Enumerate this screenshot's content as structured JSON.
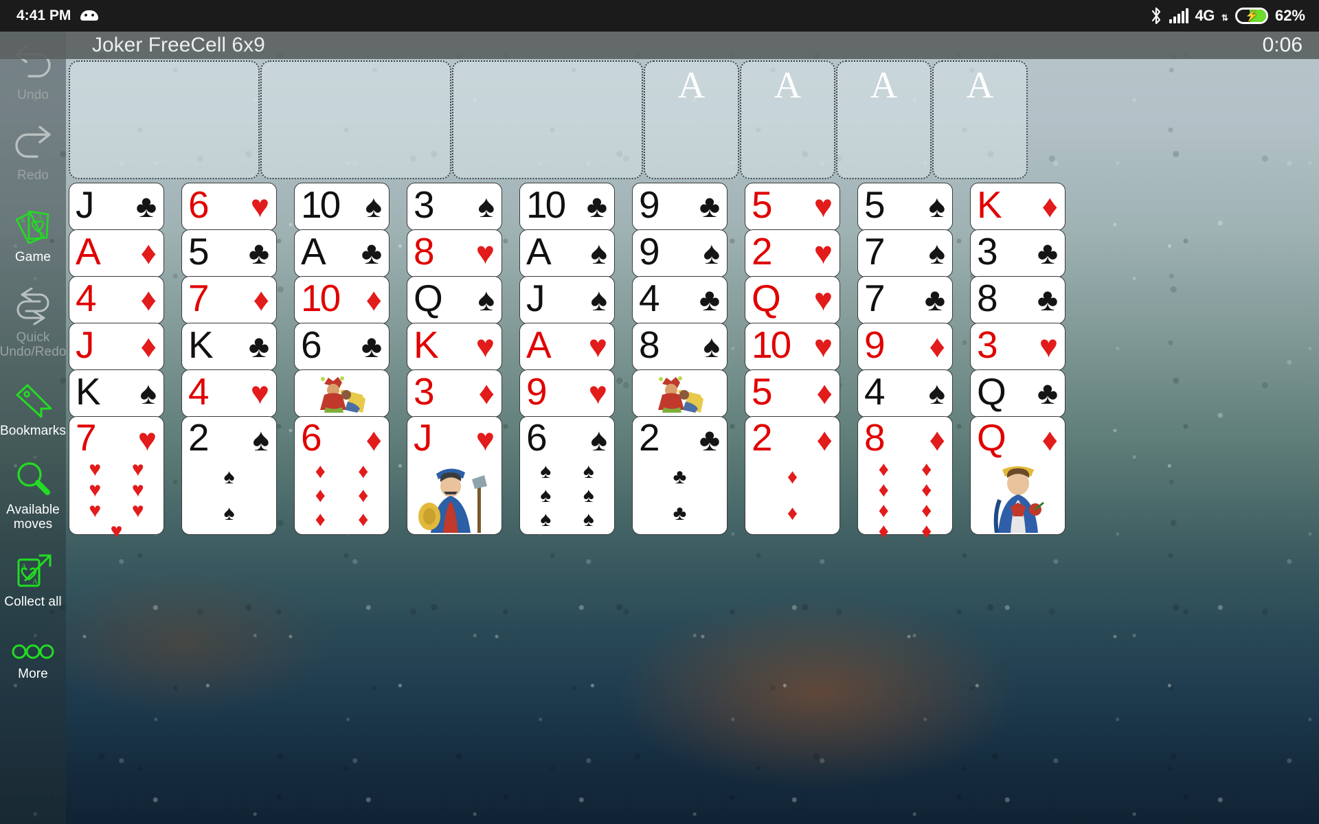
{
  "status_bar": {
    "time": "4:41 PM",
    "android_icon": "android-robot-icon",
    "bluetooth_icon": "bluetooth-icon",
    "signal_icon": "signal-bars-icon",
    "network": "4G",
    "data_arrows": "⇅",
    "battery_icon": "battery-charging-icon",
    "battery_percent": "62%",
    "battery_level": 62,
    "battery_color": "#6ddc2b"
  },
  "title_bar": {
    "title": "Joker FreeCell 6x9",
    "timer": "0:06"
  },
  "sidebar": {
    "items": [
      {
        "label": "Undo",
        "icon": "undo-arrow-icon",
        "enabled": false
      },
      {
        "label": "Redo",
        "icon": "redo-arrow-icon",
        "enabled": false
      },
      {
        "label": "Game",
        "icon": "cards-ace-icon",
        "enabled": true
      },
      {
        "label": "Quick\nUndo/Redo",
        "icon": "quick-undo-redo-icon",
        "enabled": false
      },
      {
        "label": "Bookmarks",
        "icon": "bookmark-tag-icon",
        "enabled": true
      },
      {
        "label": "Available\nmoves",
        "icon": "magnifier-icon",
        "enabled": true
      },
      {
        "label": "Collect\nall",
        "icon": "collect-all-card-arrow-icon",
        "enabled": true
      },
      {
        "label": "More",
        "icon": "three-circles-icon",
        "enabled": true
      }
    ],
    "accent_color": "#22dd22",
    "disabled_color": "#9aa3a4"
  },
  "board": {
    "free_cells": [
      {
        "occupied": false
      },
      {
        "occupied": false
      },
      {
        "occupied": false
      },
      {
        "occupied": false
      },
      {
        "occupied": false
      },
      {
        "occupied": false
      }
    ],
    "foundations": [
      {
        "placeholder": "A",
        "occupied": false
      },
      {
        "placeholder": "A",
        "occupied": false
      },
      {
        "placeholder": "A",
        "occupied": false
      },
      {
        "placeholder": "A",
        "occupied": false
      }
    ],
    "columns": [
      {
        "cards": [
          {
            "rank": "J",
            "suit": "♣",
            "color": "black",
            "type": "rank"
          },
          {
            "rank": "A",
            "suit": "♦",
            "color": "red",
            "type": "rank"
          },
          {
            "rank": "4",
            "suit": "♦",
            "color": "red",
            "type": "rank"
          },
          {
            "rank": "J",
            "suit": "♦",
            "color": "red",
            "type": "rank"
          },
          {
            "rank": "K",
            "suit": "♠",
            "color": "black",
            "type": "rank"
          },
          {
            "rank": "7",
            "suit": "♥",
            "color": "red",
            "type": "pip",
            "pips": 7
          }
        ]
      },
      {
        "cards": [
          {
            "rank": "6",
            "suit": "♥",
            "color": "red",
            "type": "rank"
          },
          {
            "rank": "5",
            "suit": "♣",
            "color": "black",
            "type": "rank"
          },
          {
            "rank": "7",
            "suit": "♦",
            "color": "red",
            "type": "rank"
          },
          {
            "rank": "K",
            "suit": "♣",
            "color": "black",
            "type": "rank"
          },
          {
            "rank": "4",
            "suit": "♥",
            "color": "red",
            "type": "rank"
          },
          {
            "rank": "2",
            "suit": "♠",
            "color": "black",
            "type": "pip",
            "pips": 2
          }
        ]
      },
      {
        "cards": [
          {
            "rank": "10",
            "suit": "♠",
            "color": "black",
            "type": "rank"
          },
          {
            "rank": "A",
            "suit": "♣",
            "color": "black",
            "type": "rank"
          },
          {
            "rank": "10",
            "suit": "♦",
            "color": "red",
            "type": "rank"
          },
          {
            "rank": "6",
            "suit": "♣",
            "color": "black",
            "type": "rank"
          },
          {
            "rank": "",
            "suit": "",
            "color": "red",
            "type": "joker"
          },
          {
            "rank": "6",
            "suit": "♦",
            "color": "red",
            "type": "pip",
            "pips": 6
          }
        ]
      },
      {
        "cards": [
          {
            "rank": "3",
            "suit": "♠",
            "color": "black",
            "type": "rank"
          },
          {
            "rank": "8",
            "suit": "♥",
            "color": "red",
            "type": "rank"
          },
          {
            "rank": "Q",
            "suit": "♠",
            "color": "black",
            "type": "rank"
          },
          {
            "rank": "K",
            "suit": "♥",
            "color": "red",
            "type": "rank"
          },
          {
            "rank": "3",
            "suit": "♦",
            "color": "red",
            "type": "rank"
          },
          {
            "rank": "J",
            "suit": "♥",
            "color": "red",
            "type": "court",
            "court": "jack"
          }
        ]
      },
      {
        "cards": [
          {
            "rank": "10",
            "suit": "♣",
            "color": "black",
            "type": "rank"
          },
          {
            "rank": "A",
            "suit": "♠",
            "color": "black",
            "type": "rank"
          },
          {
            "rank": "J",
            "suit": "♠",
            "color": "black",
            "type": "rank"
          },
          {
            "rank": "A",
            "suit": "♥",
            "color": "red",
            "type": "rank"
          },
          {
            "rank": "9",
            "suit": "♥",
            "color": "red",
            "type": "rank"
          },
          {
            "rank": "6",
            "suit": "♠",
            "color": "black",
            "type": "pip",
            "pips": 6
          }
        ]
      },
      {
        "cards": [
          {
            "rank": "9",
            "suit": "♣",
            "color": "black",
            "type": "rank"
          },
          {
            "rank": "9",
            "suit": "♠",
            "color": "black",
            "type": "rank"
          },
          {
            "rank": "4",
            "suit": "♣",
            "color": "black",
            "type": "rank"
          },
          {
            "rank": "8",
            "suit": "♠",
            "color": "black",
            "type": "rank"
          },
          {
            "rank": "",
            "suit": "",
            "color": "red",
            "type": "joker"
          },
          {
            "rank": "2",
            "suit": "♣",
            "color": "black",
            "type": "pip",
            "pips": 2
          }
        ]
      },
      {
        "cards": [
          {
            "rank": "5",
            "suit": "♥",
            "color": "red",
            "type": "rank"
          },
          {
            "rank": "2",
            "suit": "♥",
            "color": "red",
            "type": "rank"
          },
          {
            "rank": "Q",
            "suit": "♥",
            "color": "red",
            "type": "rank"
          },
          {
            "rank": "10",
            "suit": "♥",
            "color": "red",
            "type": "rank"
          },
          {
            "rank": "5",
            "suit": "♦",
            "color": "red",
            "type": "rank"
          },
          {
            "rank": "2",
            "suit": "♦",
            "color": "red",
            "type": "pip",
            "pips": 2
          }
        ]
      },
      {
        "cards": [
          {
            "rank": "5",
            "suit": "♠",
            "color": "black",
            "type": "rank"
          },
          {
            "rank": "7",
            "suit": "♠",
            "color": "black",
            "type": "rank"
          },
          {
            "rank": "7",
            "suit": "♣",
            "color": "black",
            "type": "rank"
          },
          {
            "rank": "9",
            "suit": "♦",
            "color": "red",
            "type": "rank"
          },
          {
            "rank": "4",
            "suit": "♠",
            "color": "black",
            "type": "rank"
          },
          {
            "rank": "8",
            "suit": "♦",
            "color": "red",
            "type": "pip",
            "pips": 8
          }
        ]
      },
      {
        "cards": [
          {
            "rank": "K",
            "suit": "♦",
            "color": "red",
            "type": "rank"
          },
          {
            "rank": "3",
            "suit": "♣",
            "color": "black",
            "type": "rank"
          },
          {
            "rank": "8",
            "suit": "♣",
            "color": "black",
            "type": "rank"
          },
          {
            "rank": "3",
            "suit": "♥",
            "color": "red",
            "type": "rank"
          },
          {
            "rank": "Q",
            "suit": "♣",
            "color": "black",
            "type": "rank"
          },
          {
            "rank": "Q",
            "suit": "♦",
            "color": "red",
            "type": "court",
            "court": "queen"
          }
        ]
      }
    ]
  }
}
